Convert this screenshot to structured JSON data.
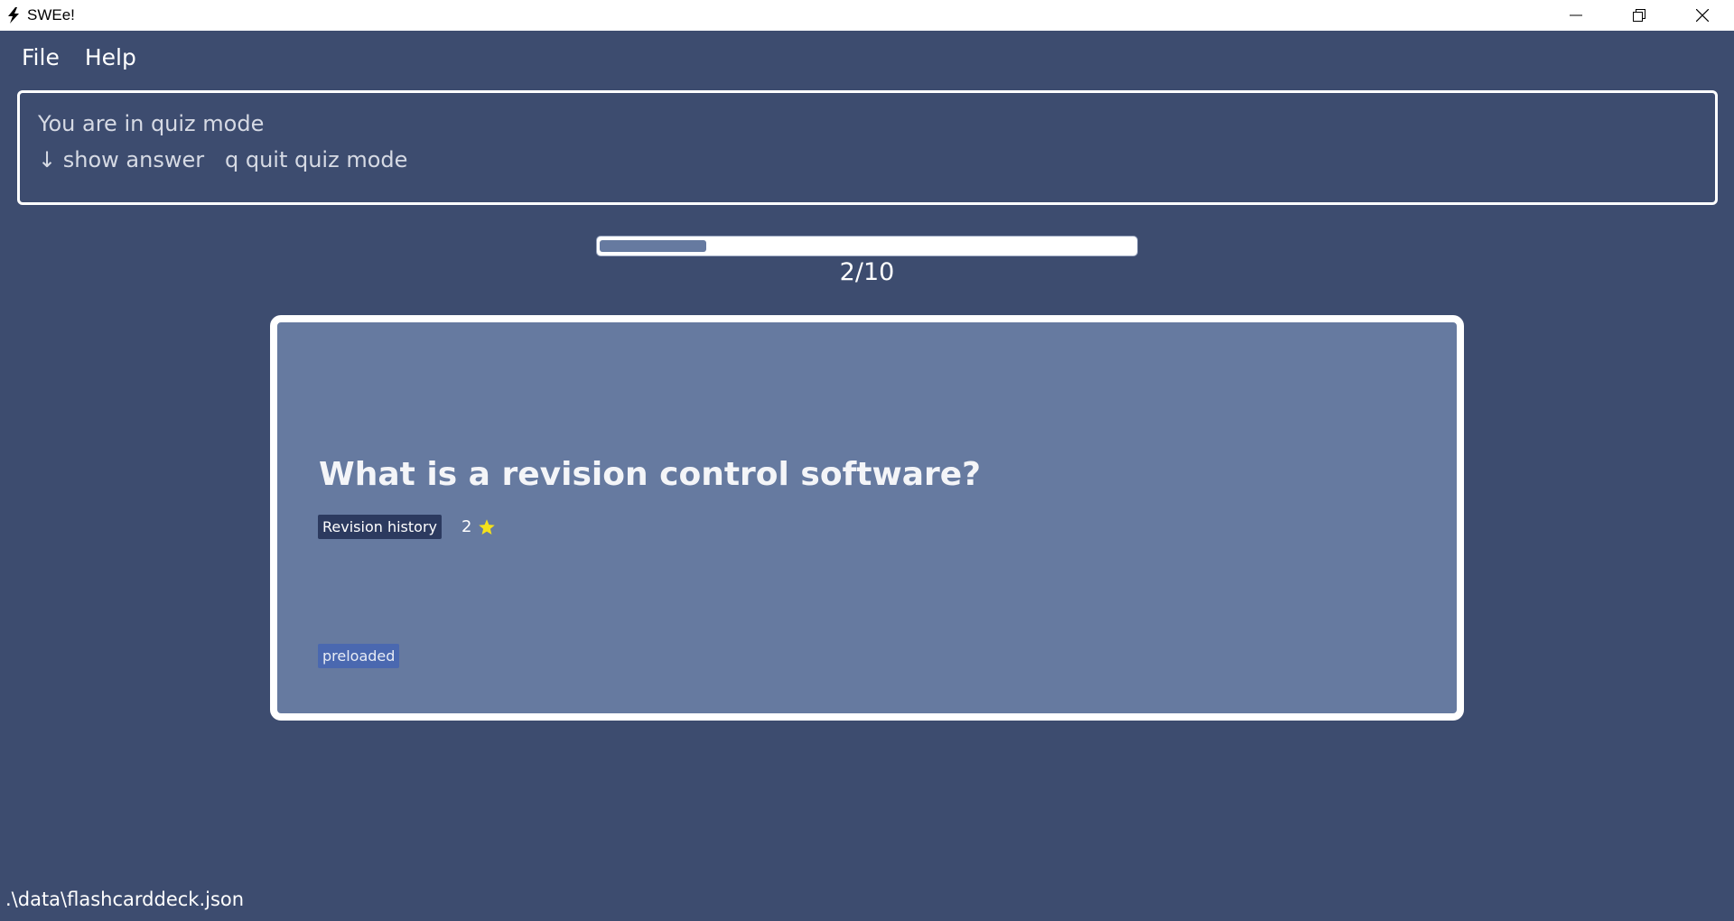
{
  "window": {
    "title": "SWEe!",
    "icon": "lightning-icon"
  },
  "menu": {
    "items": [
      {
        "label": "File"
      },
      {
        "label": "Help"
      }
    ]
  },
  "result": {
    "line1": "You are in quiz mode",
    "line2": "↓ show answer   q quit quiz mode"
  },
  "progress": {
    "current": 2,
    "total": 10,
    "fraction": 0.2,
    "label": "2/10"
  },
  "card": {
    "question": "What is a revision control software?",
    "category": "Revision history",
    "rating": "2",
    "rating_icon": "star-icon",
    "tag": "preloaded"
  },
  "status": {
    "path": ".\\data\\flashcarddeck.json"
  },
  "colors": {
    "background": "#3d4c6f",
    "card": "#667aa0",
    "category_tag": "#2c3a5f",
    "preloaded_tag": "#4a68b0",
    "star": "#f5e11a"
  }
}
